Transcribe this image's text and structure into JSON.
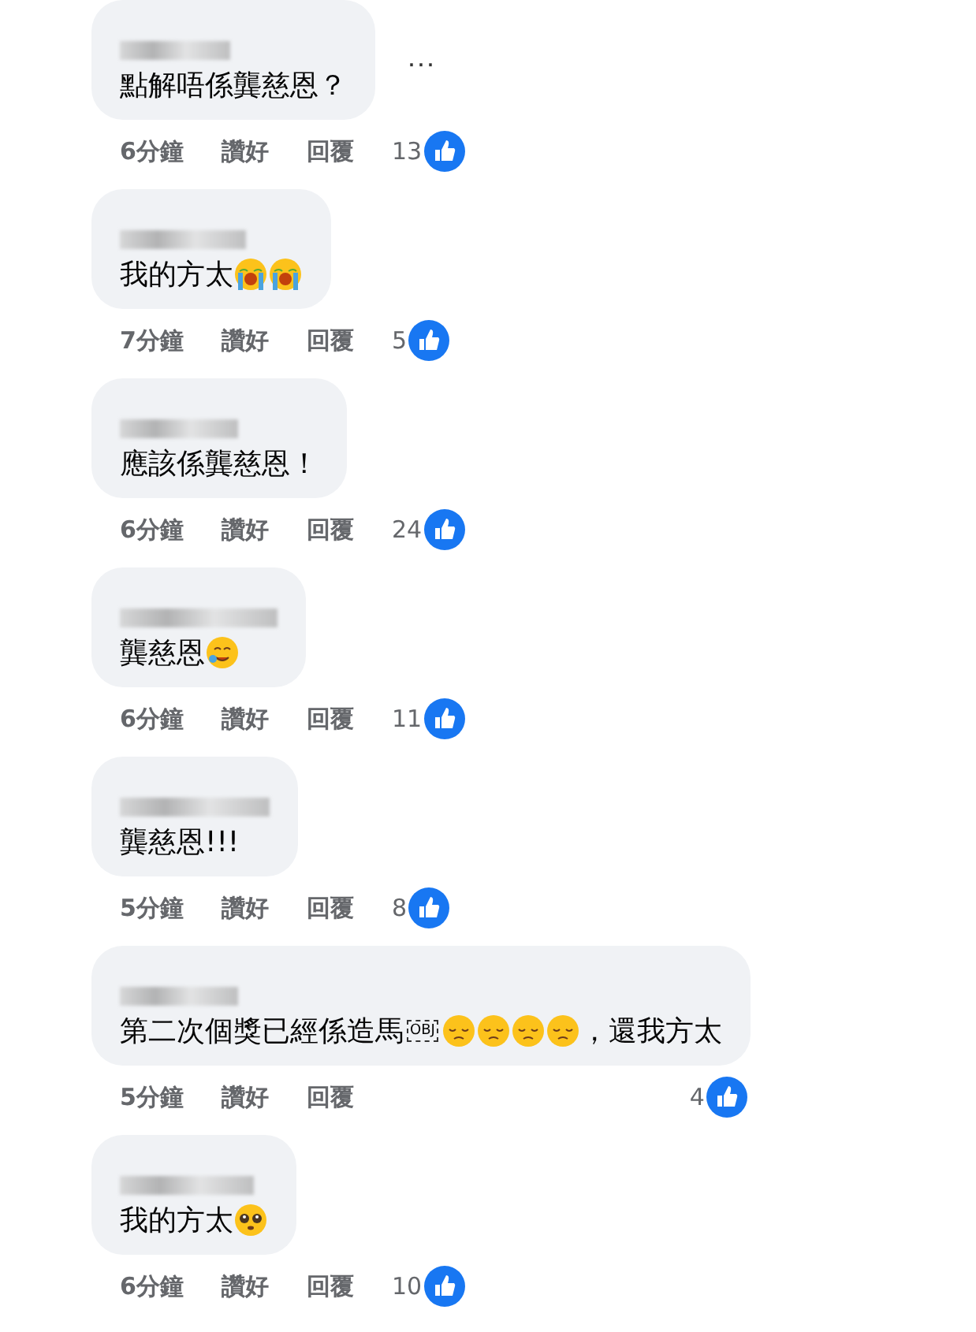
{
  "comments": [
    {
      "menu": "···",
      "parts": [
        {
          "kind": "text",
          "text": "點解唔係龔慈恩？"
        }
      ],
      "time": "6分鐘",
      "like": "讚好",
      "reply": "回覆",
      "count": "13"
    },
    {
      "parts": [
        {
          "kind": "text",
          "text": "我的方太"
        },
        {
          "kind": "crying"
        },
        {
          "kind": "crying"
        }
      ],
      "time": "7分鐘",
      "like": "讚好",
      "reply": "回覆",
      "count": "5"
    },
    {
      "parts": [
        {
          "kind": "text",
          "text": "應該係龔慈恩！"
        }
      ],
      "time": "6分鐘",
      "like": "讚好",
      "reply": "回覆",
      "count": "24"
    },
    {
      "parts": [
        {
          "kind": "text",
          "text": "龔慈恩"
        },
        {
          "kind": "tearful"
        }
      ],
      "time": "6分鐘",
      "like": "讚好",
      "reply": "回覆",
      "count": "11"
    },
    {
      "parts": [
        {
          "kind": "text",
          "text": "龔慈恩!!!"
        }
      ],
      "time": "5分鐘",
      "like": "讚好",
      "reply": "回覆",
      "count": "8"
    },
    {
      "parts": [
        {
          "kind": "text",
          "text": "第二次個獎已經係造馬"
        },
        {
          "kind": "object",
          "text": "OBJ"
        },
        {
          "kind": "pensive"
        },
        {
          "kind": "pensive"
        },
        {
          "kind": "pensive"
        },
        {
          "kind": "pensive"
        },
        {
          "kind": "text",
          "text": "，還我方太"
        }
      ],
      "time": "5分鐘",
      "like": "讚好",
      "reply": "回覆",
      "count": "4"
    },
    {
      "parts": [
        {
          "kind": "text",
          "text": "我的方太"
        },
        {
          "kind": "pleading"
        }
      ],
      "time": "6分鐘",
      "like": "讚好",
      "reply": "回覆",
      "count": "10"
    }
  ]
}
